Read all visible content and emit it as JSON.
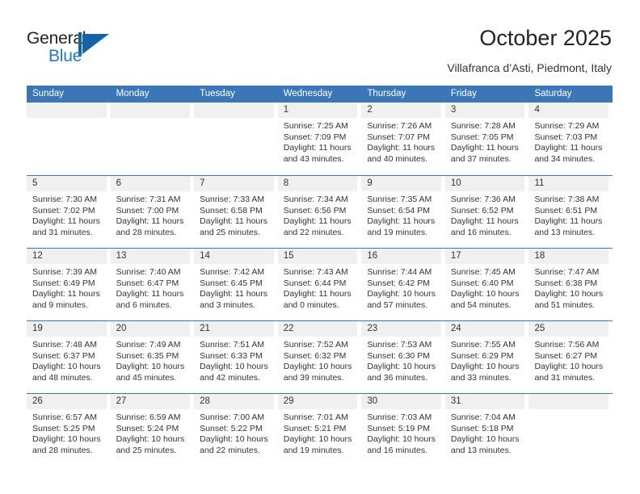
{
  "logo": {
    "text_top": "General",
    "text_bottom": "Blue",
    "accent_color": "#1464a5"
  },
  "header": {
    "title": "October 2025",
    "subtitle": "Villafranca d’Asti, Piedmont, Italy"
  },
  "colors": {
    "header_blue": "#3a76b8",
    "daynum_band": "#f0f0f0",
    "text": "#333333"
  },
  "calendar": {
    "day_headers": [
      "Sunday",
      "Monday",
      "Tuesday",
      "Wednesday",
      "Thursday",
      "Friday",
      "Saturday"
    ],
    "weeks": [
      [
        {
          "day": "",
          "sunrise": "",
          "sunset": "",
          "daylight_line1": "",
          "daylight_line2": ""
        },
        {
          "day": "",
          "sunrise": "",
          "sunset": "",
          "daylight_line1": "",
          "daylight_line2": ""
        },
        {
          "day": "",
          "sunrise": "",
          "sunset": "",
          "daylight_line1": "",
          "daylight_line2": ""
        },
        {
          "day": "1",
          "sunrise": "Sunrise: 7:25 AM",
          "sunset": "Sunset: 7:09 PM",
          "daylight_line1": "Daylight: 11 hours",
          "daylight_line2": "and 43 minutes."
        },
        {
          "day": "2",
          "sunrise": "Sunrise: 7:26 AM",
          "sunset": "Sunset: 7:07 PM",
          "daylight_line1": "Daylight: 11 hours",
          "daylight_line2": "and 40 minutes."
        },
        {
          "day": "3",
          "sunrise": "Sunrise: 7:28 AM",
          "sunset": "Sunset: 7:05 PM",
          "daylight_line1": "Daylight: 11 hours",
          "daylight_line2": "and 37 minutes."
        },
        {
          "day": "4",
          "sunrise": "Sunrise: 7:29 AM",
          "sunset": "Sunset: 7:03 PM",
          "daylight_line1": "Daylight: 11 hours",
          "daylight_line2": "and 34 minutes."
        }
      ],
      [
        {
          "day": "5",
          "sunrise": "Sunrise: 7:30 AM",
          "sunset": "Sunset: 7:02 PM",
          "daylight_line1": "Daylight: 11 hours",
          "daylight_line2": "and 31 minutes."
        },
        {
          "day": "6",
          "sunrise": "Sunrise: 7:31 AM",
          "sunset": "Sunset: 7:00 PM",
          "daylight_line1": "Daylight: 11 hours",
          "daylight_line2": "and 28 minutes."
        },
        {
          "day": "7",
          "sunrise": "Sunrise: 7:33 AM",
          "sunset": "Sunset: 6:58 PM",
          "daylight_line1": "Daylight: 11 hours",
          "daylight_line2": "and 25 minutes."
        },
        {
          "day": "8",
          "sunrise": "Sunrise: 7:34 AM",
          "sunset": "Sunset: 6:56 PM",
          "daylight_line1": "Daylight: 11 hours",
          "daylight_line2": "and 22 minutes."
        },
        {
          "day": "9",
          "sunrise": "Sunrise: 7:35 AM",
          "sunset": "Sunset: 6:54 PM",
          "daylight_line1": "Daylight: 11 hours",
          "daylight_line2": "and 19 minutes."
        },
        {
          "day": "10",
          "sunrise": "Sunrise: 7:36 AM",
          "sunset": "Sunset: 6:52 PM",
          "daylight_line1": "Daylight: 11 hours",
          "daylight_line2": "and 16 minutes."
        },
        {
          "day": "11",
          "sunrise": "Sunrise: 7:38 AM",
          "sunset": "Sunset: 6:51 PM",
          "daylight_line1": "Daylight: 11 hours",
          "daylight_line2": "and 13 minutes."
        }
      ],
      [
        {
          "day": "12",
          "sunrise": "Sunrise: 7:39 AM",
          "sunset": "Sunset: 6:49 PM",
          "daylight_line1": "Daylight: 11 hours",
          "daylight_line2": "and 9 minutes."
        },
        {
          "day": "13",
          "sunrise": "Sunrise: 7:40 AM",
          "sunset": "Sunset: 6:47 PM",
          "daylight_line1": "Daylight: 11 hours",
          "daylight_line2": "and 6 minutes."
        },
        {
          "day": "14",
          "sunrise": "Sunrise: 7:42 AM",
          "sunset": "Sunset: 6:45 PM",
          "daylight_line1": "Daylight: 11 hours",
          "daylight_line2": "and 3 minutes."
        },
        {
          "day": "15",
          "sunrise": "Sunrise: 7:43 AM",
          "sunset": "Sunset: 6:44 PM",
          "daylight_line1": "Daylight: 11 hours",
          "daylight_line2": "and 0 minutes."
        },
        {
          "day": "16",
          "sunrise": "Sunrise: 7:44 AM",
          "sunset": "Sunset: 6:42 PM",
          "daylight_line1": "Daylight: 10 hours",
          "daylight_line2": "and 57 minutes."
        },
        {
          "day": "17",
          "sunrise": "Sunrise: 7:45 AM",
          "sunset": "Sunset: 6:40 PM",
          "daylight_line1": "Daylight: 10 hours",
          "daylight_line2": "and 54 minutes."
        },
        {
          "day": "18",
          "sunrise": "Sunrise: 7:47 AM",
          "sunset": "Sunset: 6:38 PM",
          "daylight_line1": "Daylight: 10 hours",
          "daylight_line2": "and 51 minutes."
        }
      ],
      [
        {
          "day": "19",
          "sunrise": "Sunrise: 7:48 AM",
          "sunset": "Sunset: 6:37 PM",
          "daylight_line1": "Daylight: 10 hours",
          "daylight_line2": "and 48 minutes."
        },
        {
          "day": "20",
          "sunrise": "Sunrise: 7:49 AM",
          "sunset": "Sunset: 6:35 PM",
          "daylight_line1": "Daylight: 10 hours",
          "daylight_line2": "and 45 minutes."
        },
        {
          "day": "21",
          "sunrise": "Sunrise: 7:51 AM",
          "sunset": "Sunset: 6:33 PM",
          "daylight_line1": "Daylight: 10 hours",
          "daylight_line2": "and 42 minutes."
        },
        {
          "day": "22",
          "sunrise": "Sunrise: 7:52 AM",
          "sunset": "Sunset: 6:32 PM",
          "daylight_line1": "Daylight: 10 hours",
          "daylight_line2": "and 39 minutes."
        },
        {
          "day": "23",
          "sunrise": "Sunrise: 7:53 AM",
          "sunset": "Sunset: 6:30 PM",
          "daylight_line1": "Daylight: 10 hours",
          "daylight_line2": "and 36 minutes."
        },
        {
          "day": "24",
          "sunrise": "Sunrise: 7:55 AM",
          "sunset": "Sunset: 6:29 PM",
          "daylight_line1": "Daylight: 10 hours",
          "daylight_line2": "and 33 minutes."
        },
        {
          "day": "25",
          "sunrise": "Sunrise: 7:56 AM",
          "sunset": "Sunset: 6:27 PM",
          "daylight_line1": "Daylight: 10 hours",
          "daylight_line2": "and 31 minutes."
        }
      ],
      [
        {
          "day": "26",
          "sunrise": "Sunrise: 6:57 AM",
          "sunset": "Sunset: 5:25 PM",
          "daylight_line1": "Daylight: 10 hours",
          "daylight_line2": "and 28 minutes."
        },
        {
          "day": "27",
          "sunrise": "Sunrise: 6:59 AM",
          "sunset": "Sunset: 5:24 PM",
          "daylight_line1": "Daylight: 10 hours",
          "daylight_line2": "and 25 minutes."
        },
        {
          "day": "28",
          "sunrise": "Sunrise: 7:00 AM",
          "sunset": "Sunset: 5:22 PM",
          "daylight_line1": "Daylight: 10 hours",
          "daylight_line2": "and 22 minutes."
        },
        {
          "day": "29",
          "sunrise": "Sunrise: 7:01 AM",
          "sunset": "Sunset: 5:21 PM",
          "daylight_line1": "Daylight: 10 hours",
          "daylight_line2": "and 19 minutes."
        },
        {
          "day": "30",
          "sunrise": "Sunrise: 7:03 AM",
          "sunset": "Sunset: 5:19 PM",
          "daylight_line1": "Daylight: 10 hours",
          "daylight_line2": "and 16 minutes."
        },
        {
          "day": "31",
          "sunrise": "Sunrise: 7:04 AM",
          "sunset": "Sunset: 5:18 PM",
          "daylight_line1": "Daylight: 10 hours",
          "daylight_line2": "and 13 minutes."
        },
        {
          "day": "",
          "sunrise": "",
          "sunset": "",
          "daylight_line1": "",
          "daylight_line2": ""
        }
      ]
    ]
  }
}
